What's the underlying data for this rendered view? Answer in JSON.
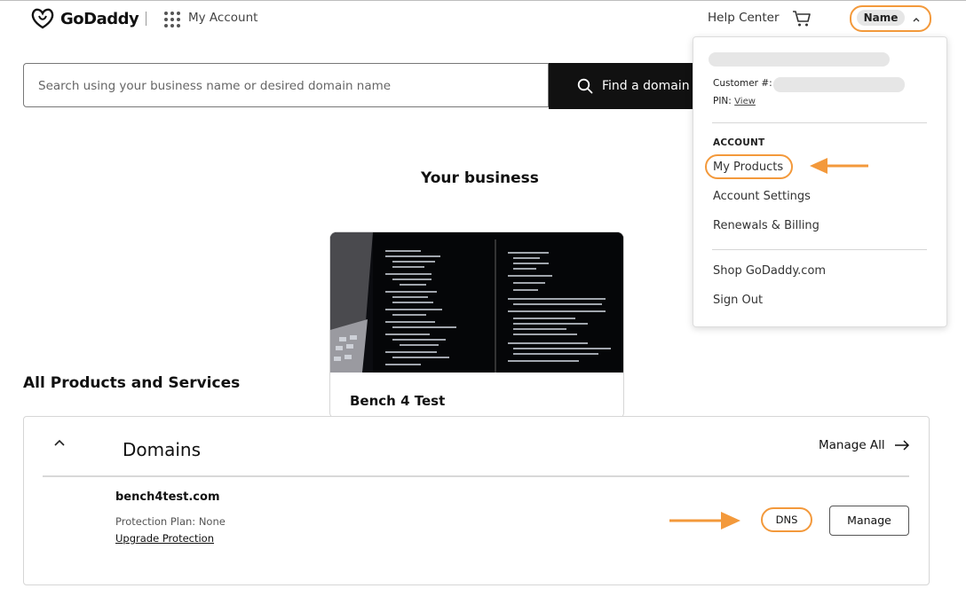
{
  "header": {
    "brand": "GoDaddy",
    "my_account": "My Account",
    "help_center": "Help Center",
    "user_name": "Name"
  },
  "search": {
    "placeholder": "Search using your business name or desired domain name",
    "button_label": "Find a domain"
  },
  "business": {
    "heading": "Your business",
    "card_title": "Bench 4 Test"
  },
  "products": {
    "heading": "All Products and Services",
    "domains": {
      "title": "Domains",
      "manage_all": "Manage All",
      "items": [
        {
          "domain": "bench4test.com",
          "protection": "Protection Plan: None",
          "upgrade_link": "Upgrade Protection",
          "dns_label": "DNS",
          "manage_label": "Manage"
        }
      ]
    }
  },
  "account_menu": {
    "customer_label": "Customer #:",
    "pin_label": "PIN:",
    "pin_link": "View",
    "section_label": "ACCOUNT",
    "items": [
      "My Products",
      "Account Settings",
      "Renewals & Billing"
    ],
    "other_items": [
      "Shop GoDaddy.com",
      "Sign Out"
    ]
  },
  "colors": {
    "highlight": "#f3993b",
    "button_dark": "#111111"
  }
}
